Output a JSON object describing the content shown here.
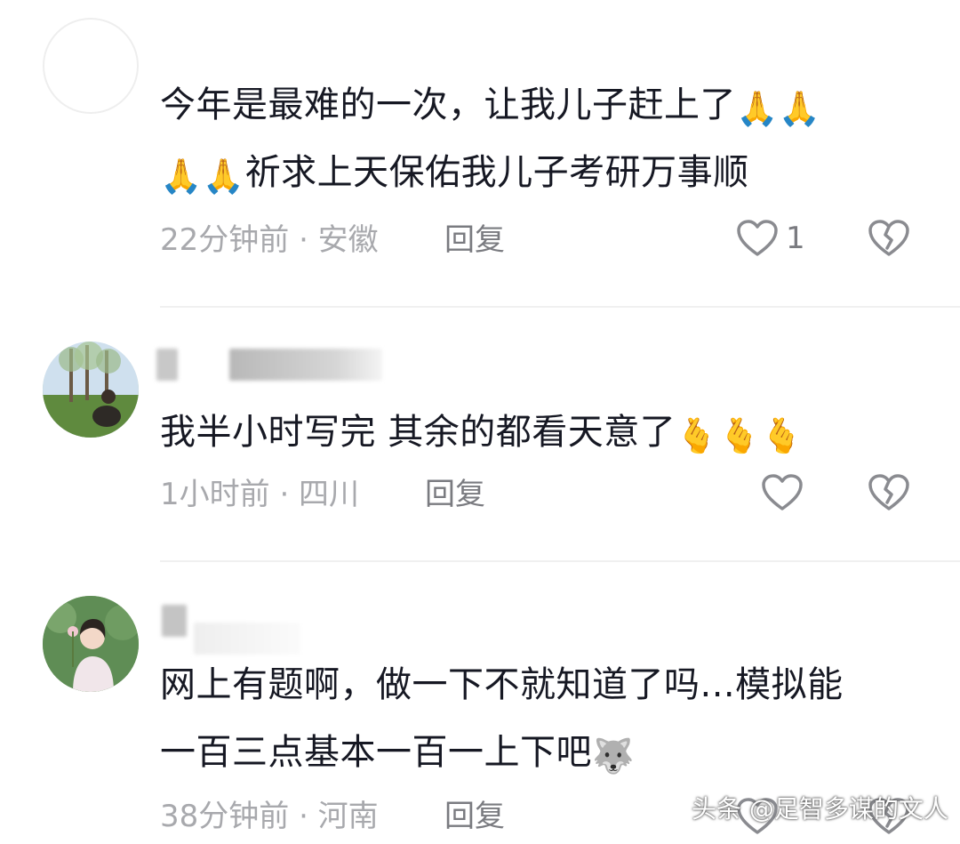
{
  "comments": [
    {
      "text_line1": "今年是最难的一次，让我儿子赶上了",
      "line1_emoji": "🙏🙏",
      "line2_emoji": "🙏🙏",
      "text_line2": "祈求上天保佑我儿子考研万事顺",
      "meta": "22分钟前 · 安徽",
      "reply": "回复",
      "like_count": "1"
    },
    {
      "text": "我半小时写完 其余的都看天意了",
      "emoji": "🫰🫰🫰",
      "meta": "1小时前 · 四川",
      "reply": "回复"
    },
    {
      "text_line1": "网上有题啊，做一下不就知道了吗...模拟能",
      "text_line2": "一百三点基本一百一上下吧",
      "emoji": "🐺",
      "meta": "38分钟前 · 河南",
      "reply": "回复"
    }
  ],
  "watermark": "头条 @足智多谋的文人",
  "icons": {
    "like": "heart-outline-icon",
    "dislike": "broken-heart-icon"
  },
  "colors": {
    "text": "#161823",
    "meta": "#a8a9ad",
    "reply": "#7a7b80"
  }
}
